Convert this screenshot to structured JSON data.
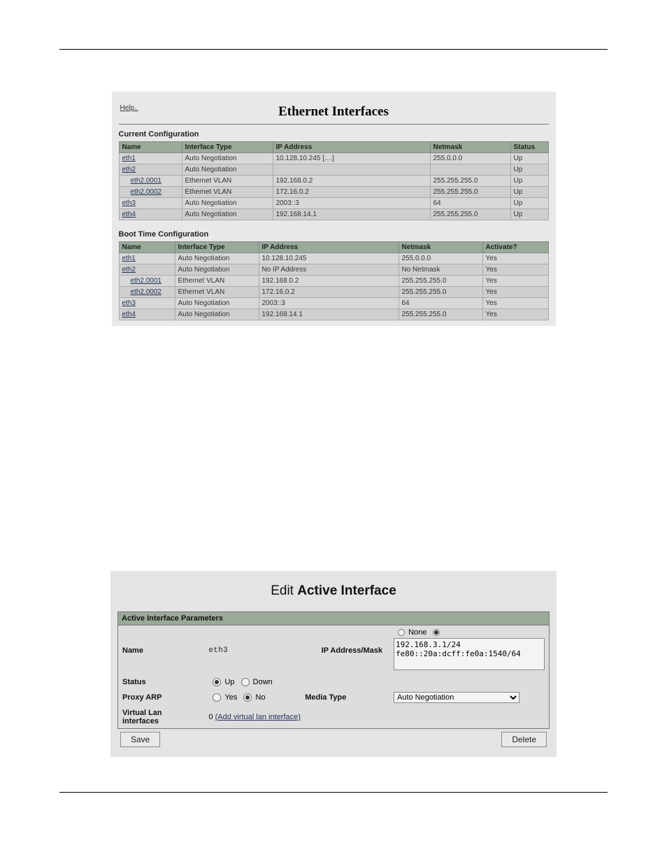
{
  "panel1": {
    "help_label": "Help..",
    "title": "Ethernet Interfaces",
    "current_title": "Current Configuration",
    "boot_title": "Boot Time Configuration",
    "current_headers": [
      "Name",
      "Interface Type",
      "IP Address",
      "Netmask",
      "Status"
    ],
    "boot_headers": [
      "Name",
      "Interface Type",
      "IP Address",
      "Netmask",
      "Activate?"
    ],
    "current_rows": [
      {
        "name": "eth1",
        "indent": false,
        "type": "Auto Negotiation",
        "ip": "10.128.10.245 [....]",
        "mask": "255.0.0.0",
        "status": "Up"
      },
      {
        "name": "eth2",
        "indent": false,
        "type": "Auto Negotiation",
        "ip": "",
        "mask": "",
        "status": "Up"
      },
      {
        "name": "eth2.0001",
        "indent": true,
        "type": "Ethernet VLAN",
        "ip": "192.168.0.2",
        "mask": "255.255.255.0",
        "status": "Up"
      },
      {
        "name": "eth2.0002",
        "indent": true,
        "type": "Ethernet VLAN",
        "ip": "172.16.0.2",
        "mask": "255.255.255.0",
        "status": "Up"
      },
      {
        "name": "eth3",
        "indent": false,
        "type": "Auto Negotiation",
        "ip": "2003::3",
        "mask": "64",
        "status": "Up"
      },
      {
        "name": "eth4",
        "indent": false,
        "type": "Auto Negotiation",
        "ip": "192.168.14.1",
        "mask": "255.255.255.0",
        "status": "Up"
      }
    ],
    "boot_rows": [
      {
        "name": "eth1",
        "indent": false,
        "type": "Auto Negotiation",
        "ip": "10.128.10.245",
        "mask": "255.0.0.0",
        "status": "Yes"
      },
      {
        "name": "eth2",
        "indent": false,
        "type": "Auto Negotiation",
        "ip": "No IP Address",
        "mask": "No Netmask",
        "status": "Yes"
      },
      {
        "name": "eth2.0001",
        "indent": true,
        "type": "Ethernet VLAN",
        "ip": "192.168.0.2",
        "mask": "255.255.255.0",
        "status": "Yes"
      },
      {
        "name": "eth2.0002",
        "indent": true,
        "type": "Ethernet VLAN",
        "ip": "172.16.0.2",
        "mask": "255.255.255.0",
        "status": "Yes"
      },
      {
        "name": "eth3",
        "indent": false,
        "type": "Auto Negotiation",
        "ip": "2003::3",
        "mask": "64",
        "status": "Yes"
      },
      {
        "name": "eth4",
        "indent": false,
        "type": "Auto Negotiation",
        "ip": "192.168.14.1",
        "mask": "255.255.255.0",
        "status": "Yes"
      }
    ]
  },
  "panel2": {
    "title_prefix": "Edit ",
    "title_bold": "Active Interface",
    "box_title": "Active Interface Parameters",
    "labels": {
      "name": "Name",
      "ip": "IP Address/Mask",
      "status": "Status",
      "proxy": "Proxy ARP",
      "media": "Media Type",
      "vlan": "Virtual Lan interfaces"
    },
    "name_value": "eth3",
    "none_label": "None",
    "ip_value": "192.168.3.1/24\nfe80::20a:dcff:fe0a:1540/64",
    "status_up": "Up",
    "status_down": "Down",
    "proxy_yes": "Yes",
    "proxy_no": "No",
    "media_value": "Auto Negotiation",
    "vlan_count": "0",
    "vlan_link": "(Add virtual lan interface)",
    "save_label": "Save",
    "delete_label": "Delete"
  }
}
